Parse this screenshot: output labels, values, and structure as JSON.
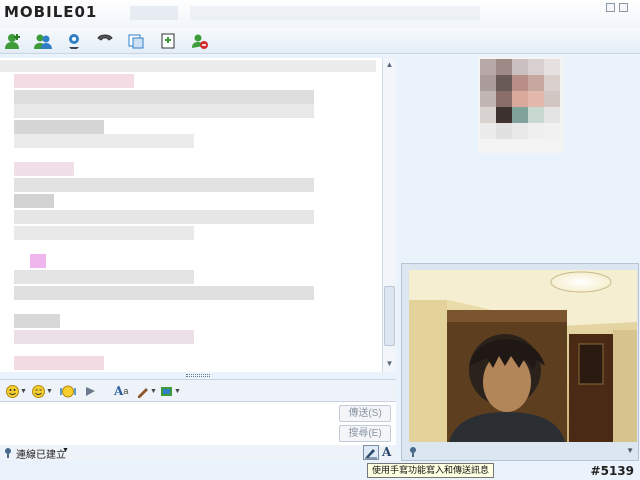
{
  "watermark": {
    "brand": "MOBILE01",
    "tag": "#5139"
  },
  "toolbar": {
    "tools": [
      {
        "name": "invite-contact-icon",
        "color": "#3d9b3a"
      },
      {
        "name": "send-files-icon",
        "color": "#2f7fc6"
      },
      {
        "name": "video-call-icon",
        "color": "#2f7fc6"
      },
      {
        "name": "call-icon",
        "color": "#d9532f"
      },
      {
        "name": "activities-icon",
        "color": "#2f7fc6"
      },
      {
        "name": "games-icon",
        "color": "#3d9b3a"
      },
      {
        "name": "block-icon",
        "color": "#d22c2c"
      }
    ]
  },
  "format_bar": {
    "items": [
      {
        "name": "emoticon-icon",
        "glyph": "☺"
      },
      {
        "name": "wink-icon",
        "glyph": "☻"
      },
      {
        "name": "voice-clip-icon",
        "glyph": "◉"
      },
      {
        "name": "nudge-icon",
        "glyph": "◈"
      },
      {
        "name": "font-icon",
        "glyph": "A"
      },
      {
        "name": "background-icon",
        "glyph": "✎"
      },
      {
        "name": "more-icon",
        "glyph": "▦"
      }
    ]
  },
  "input": {
    "send_label": "傳送(S)",
    "search_label": "搜尋(E)"
  },
  "status": {
    "text": "連線已建立"
  },
  "tooltip": {
    "text": "使用手寫功能寫入和傳送訊息"
  },
  "colors": {
    "accent": "#2f7fc6",
    "panel": "#dce6f1",
    "tooltip_bg": "#ffffe1"
  }
}
